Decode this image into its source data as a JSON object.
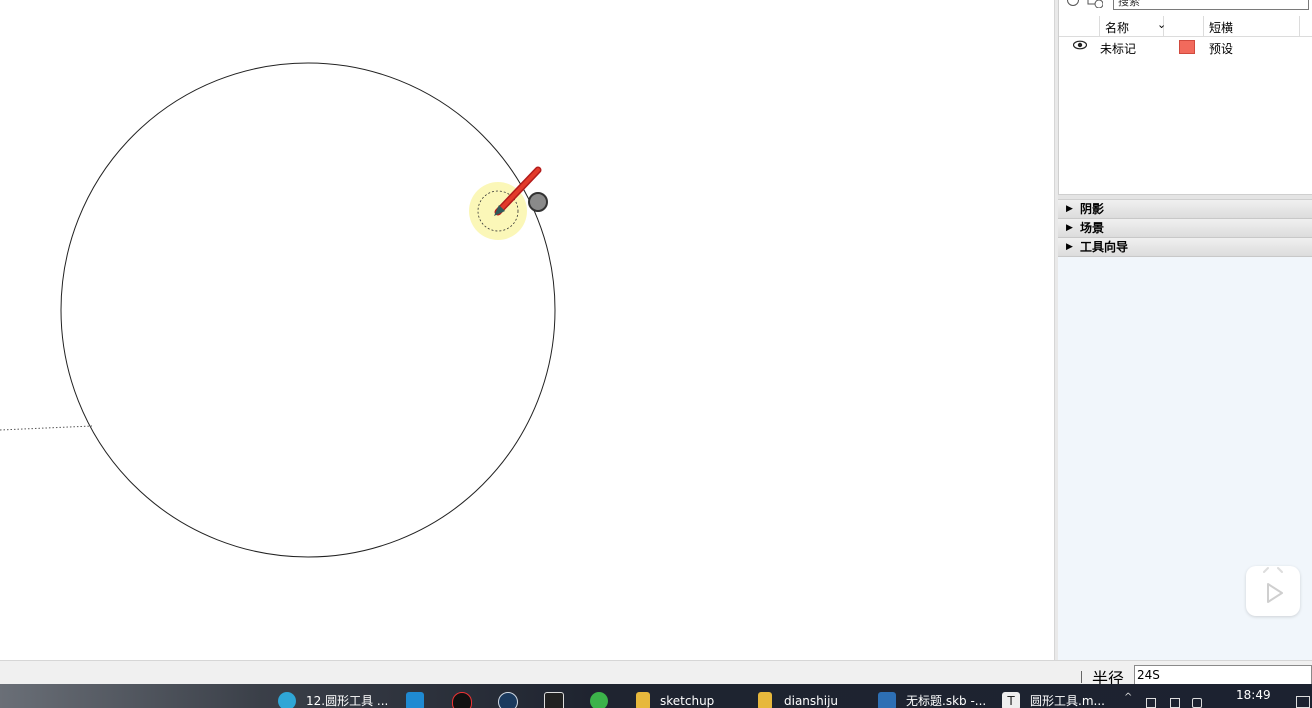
{
  "panel": {
    "search_placeholder": "搜索",
    "columns": {
      "name": "名称",
      "short": "短横"
    },
    "rows": [
      {
        "name": "未标记",
        "preset": "预设",
        "color": "#f26a5c"
      }
    ],
    "trays": [
      {
        "label": "阴影"
      },
      {
        "label": "场景"
      },
      {
        "label": "工具向导"
      }
    ]
  },
  "statusbar": {
    "vcb_label": "半径",
    "vcb_value": "24S"
  },
  "taskbar": {
    "items": [
      {
        "label": "12.圆形工具 ...",
        "icon": "edge-icon",
        "color": "#2fa6d6"
      },
      {
        "label": "",
        "icon": "vscode-icon",
        "color": "#1f8ad2"
      },
      {
        "label": "",
        "icon": "qq-icon",
        "color": "#111111"
      },
      {
        "label": "",
        "icon": "steam-icon",
        "color": "#1b3a5e"
      },
      {
        "label": "",
        "icon": "epic-icon",
        "color": "#222222"
      },
      {
        "label": "",
        "icon": "wechat-icon",
        "color": "#3cb34a"
      },
      {
        "label": "sketchup",
        "icon": "folder-icon",
        "color": "#e7b83c"
      },
      {
        "label": "dianshiju",
        "icon": "folder-icon",
        "color": "#e7b83c"
      },
      {
        "label": "无标题.skb -...",
        "icon": "sketchup-icon",
        "color": "#2d6fb4"
      },
      {
        "label": "圆形工具.m...",
        "icon": "typora-icon",
        "color": "#eeeeee"
      }
    ],
    "clock": "18:49"
  },
  "icons": {
    "pencil": "pencil-icon",
    "play": "play-icon",
    "eye": "eye-icon"
  }
}
